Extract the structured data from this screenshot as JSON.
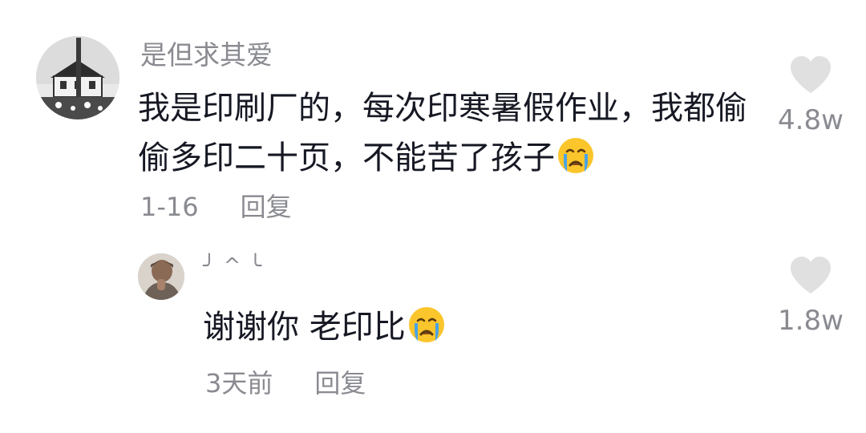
{
  "main_comment": {
    "username": "是但求其爱",
    "text": "我是印刷厂的，每次印寒暑假作业，我都偷偷多印二十页，不能苦了孩子",
    "emoji": "crying-face",
    "date": "1-16",
    "reply_label": "回复",
    "like_count": "4.8w"
  },
  "reply_comment": {
    "username": "╯^╰",
    "text": "谢谢你 老印比",
    "emoji": "crying-face",
    "date": "3天前",
    "reply_label": "回复",
    "like_count": "1.8w"
  },
  "colors": {
    "primary_text": "#161823",
    "secondary_text": "#8a8b91",
    "heart": "#e0e0e0",
    "emoji_face": "#fbc52c",
    "emoji_tear": "#4aa3e6"
  }
}
